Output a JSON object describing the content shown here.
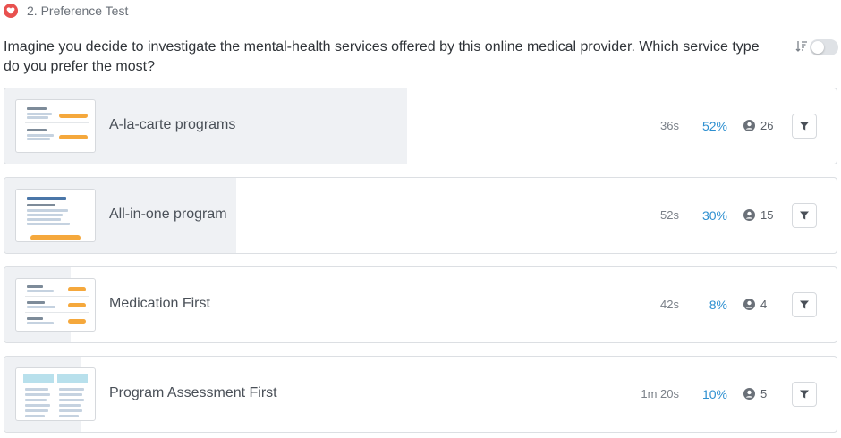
{
  "header": {
    "section_label": "2. Preference Test",
    "icon": "heart-icon",
    "icon_color": "#e8514f"
  },
  "question": {
    "text": "Imagine you decide to investigate the mental-health services offered by this online medical provider. Which service type do you prefer the most?"
  },
  "controls": {
    "sort_icon": "sort-icon",
    "toggle_on": false
  },
  "options": [
    {
      "label": "A-la-carte programs",
      "time": "36s",
      "percent": "52%",
      "percent_value": 52,
      "count": "26"
    },
    {
      "label": "All-in-one program",
      "time": "52s",
      "percent": "30%",
      "percent_value": 30,
      "count": "15"
    },
    {
      "label": "Medication First",
      "time": "42s",
      "percent": "8%",
      "percent_value": 8,
      "count": "4"
    },
    {
      "label": "Program Assessment First",
      "time": "1m 20s",
      "percent": "10%",
      "percent_value": 10,
      "count": "5"
    }
  ],
  "colors": {
    "accent": "#2d8fd0",
    "bar_fill": "#eff1f4",
    "thumb_button": "#f5a83c"
  }
}
